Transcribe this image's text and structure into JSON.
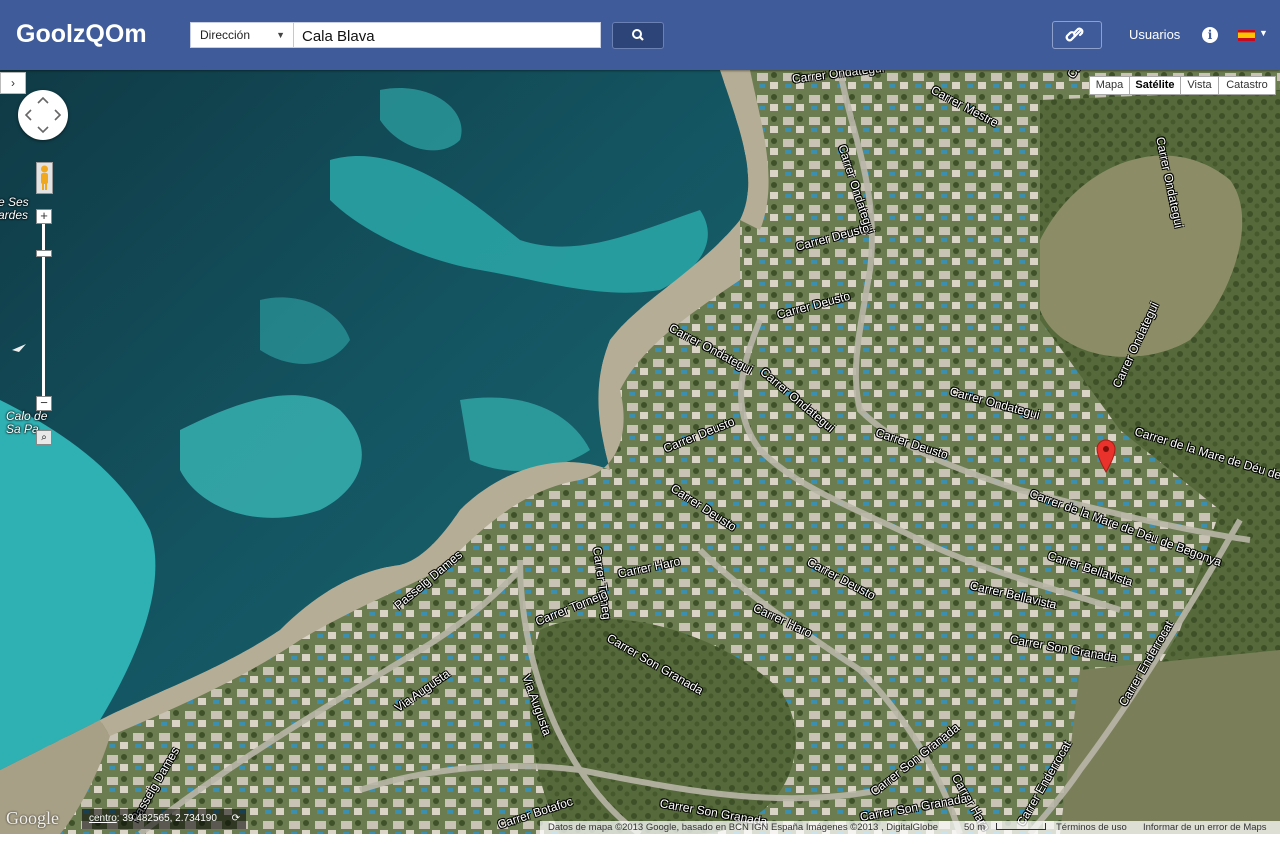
{
  "header": {
    "logo": "GoolzQOm",
    "mode_select": "Dirección",
    "search_value": "Cala Blava",
    "users_label": "Usuarios",
    "info_icon": "info-icon",
    "language_flag": "spain-flag-icon"
  },
  "map_types": [
    {
      "label": "Mapa"
    },
    {
      "label": "Satélite"
    },
    {
      "label": "Vista"
    },
    {
      "label": "Catastro"
    }
  ],
  "active_map_type": "Satélite",
  "controls": {
    "side_toggle": "›",
    "zoom_in": "+",
    "zoom_out": "−"
  },
  "places": [
    {
      "text": "e Ses\nardes"
    },
    {
      "text": "Calo de\nSa Pa..."
    }
  ],
  "streets": [
    {
      "text": "Carrer Ondategui"
    },
    {
      "text": "Carrer Mestre"
    },
    {
      "text": "Carrer Ondategui"
    },
    {
      "text": "Carrer Ondategui"
    },
    {
      "text": "Carrer Ondategui"
    },
    {
      "text": "Carrer Deusto"
    },
    {
      "text": "Carrer Deusto"
    },
    {
      "text": "Carrer Ondategui"
    },
    {
      "text": "Carrer Ondategui"
    },
    {
      "text": "Carrer Ondategui"
    },
    {
      "text": "Carrer Ondategui"
    },
    {
      "text": "Carrer de la Mare de Déu de Begon"
    },
    {
      "text": "Carrer Deusto"
    },
    {
      "text": "Carrer de la Mare de Déu de Begonya"
    },
    {
      "text": "Carrer Deusto"
    },
    {
      "text": "Carrer Tomeg"
    },
    {
      "text": "Carrer Deusto"
    },
    {
      "text": "Carrer Haro"
    },
    {
      "text": "Carrer Deusto"
    },
    {
      "text": "Carrer Bellavista"
    },
    {
      "text": "Carrer Bellavista"
    },
    {
      "text": "Passeig Dames"
    },
    {
      "text": "Carrer Torneig"
    },
    {
      "text": "Carrer Haro"
    },
    {
      "text": "Carrer Son Granada"
    },
    {
      "text": "Carrer Son Granada"
    },
    {
      "text": "Carrer Enderrocat"
    },
    {
      "text": "Via Augusta"
    },
    {
      "text": "Via Augusta"
    },
    {
      "text": "Passeig Dames"
    },
    {
      "text": "Carrer Son Granada"
    },
    {
      "text": "Carrer Son Granada"
    },
    {
      "text": "Carrer Haro"
    },
    {
      "text": "Carrer Enderrocat"
    },
    {
      "text": "Carrer Botafoc"
    },
    {
      "text": "Carrer Son Granada"
    }
  ],
  "footer": {
    "google": "Google",
    "centro_label": "centro",
    "coordinates": "39.482565, 2.734190",
    "attribution": "Datos de mapa ©2013 Google, basado en BCN IGN España Imágenes ©2013 , DigitalGlobe",
    "scale": "50 m",
    "terms": "Términos de uso",
    "report": "Informar de un error de Maps"
  }
}
